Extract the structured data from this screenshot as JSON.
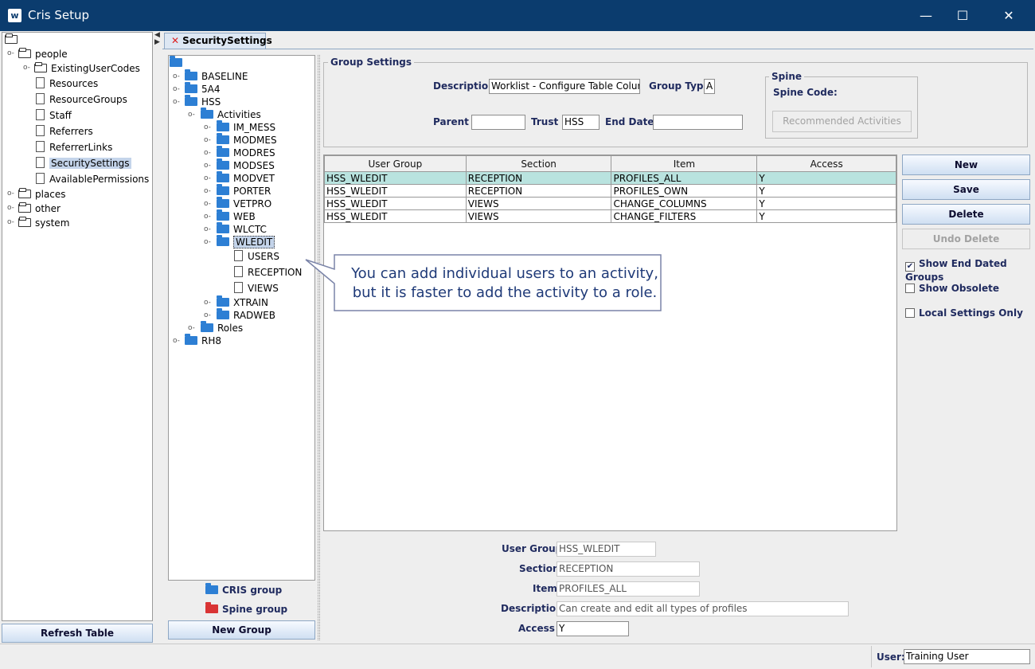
{
  "window": {
    "title": "Cris Setup",
    "minimize": "—",
    "maximize": "☐",
    "close": "✕"
  },
  "left_tree": {
    "items": [
      {
        "label": "people"
      },
      {
        "label": "ExistingUserCodes"
      },
      {
        "label": "Resources"
      },
      {
        "label": "ResourceGroups"
      },
      {
        "label": "Staff"
      },
      {
        "label": "Referrers"
      },
      {
        "label": "ReferrerLinks"
      },
      {
        "label": "SecuritySettings"
      },
      {
        "label": "AvailablePermissions"
      },
      {
        "label": "places"
      },
      {
        "label": "other"
      },
      {
        "label": "system"
      }
    ],
    "refresh_label": "Refresh Table"
  },
  "tab": {
    "label": "SecuritySettings",
    "close": "✕"
  },
  "group_tree": {
    "items": [
      {
        "label": "BASELINE"
      },
      {
        "label": "5A4"
      },
      {
        "label": "HSS"
      },
      {
        "label": "Activities"
      },
      {
        "label": "IM_MESS"
      },
      {
        "label": "MODMES"
      },
      {
        "label": "MODRES"
      },
      {
        "label": "MODSES"
      },
      {
        "label": "MODVET"
      },
      {
        "label": "PORTER"
      },
      {
        "label": "VETPRO"
      },
      {
        "label": "WEB"
      },
      {
        "label": "WLCTC"
      },
      {
        "label": "WLEDIT"
      },
      {
        "label": "USERS"
      },
      {
        "label": "RECEPTION"
      },
      {
        "label": "VIEWS"
      },
      {
        "label": "XTRAIN"
      },
      {
        "label": "RADWEB"
      },
      {
        "label": "Roles"
      },
      {
        "label": "RH8"
      }
    ],
    "legend_cris": "CRIS group",
    "legend_spine": "Spine group",
    "new_group_label": "New Group"
  },
  "group_settings": {
    "legend": "Group Settings",
    "description_label": "Description",
    "description_value": "Worklist - Configure Table Column",
    "group_type_label": "Group Type",
    "group_type_value": "A",
    "parent_label": "Parent",
    "parent_value": "",
    "trust_label": "Trust",
    "trust_value": "HSS",
    "end_date_label": "End Date",
    "end_date_value": "",
    "spine_legend": "Spine",
    "spine_code_label": "Spine Code:",
    "recommended_label": "Recommended Activities"
  },
  "table": {
    "headers": [
      "User Group",
      "Section",
      "Item",
      "Access"
    ],
    "rows": [
      [
        "HSS_WLEDIT",
        "RECEPTION",
        "PROFILES_ALL",
        "Y"
      ],
      [
        "HSS_WLEDIT",
        "RECEPTION",
        "PROFILES_OWN",
        "Y"
      ],
      [
        "HSS_WLEDIT",
        "VIEWS",
        "CHANGE_COLUMNS",
        "Y"
      ],
      [
        "HSS_WLEDIT",
        "VIEWS",
        "CHANGE_FILTERS",
        "Y"
      ]
    ]
  },
  "actions": {
    "new": "New",
    "save": "Save",
    "delete": "Delete",
    "undo_delete": "Undo Delete"
  },
  "options": {
    "show_end_dated": "Show End Dated Groups",
    "show_end_dated_checked": true,
    "show_obsolete": "Show Obsolete",
    "local_only": "Local Settings Only",
    "check_mark": "✔"
  },
  "callout": {
    "line1": "You can add individual users to an activity,",
    "line2": "but it is faster to add the activity to a role."
  },
  "detail": {
    "user_group_label": "User Group",
    "user_group_value": "HSS_WLEDIT",
    "section_label": "Section",
    "section_value": "RECEPTION",
    "item_label": "Item",
    "item_value": "PROFILES_ALL",
    "description_label": "Description",
    "description_value": "Can create and edit all types of profiles",
    "access_label": "Access",
    "access_value": "Y"
  },
  "status": {
    "user_label": "User:",
    "user_value": "Training User"
  }
}
